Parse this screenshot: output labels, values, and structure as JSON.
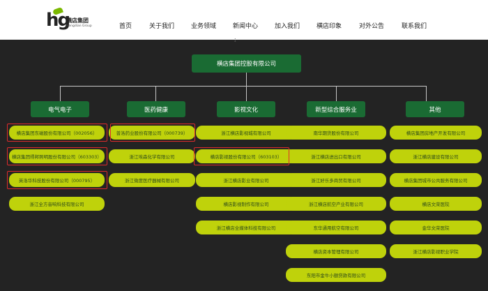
{
  "logo": {
    "mark": "hg",
    "cn": "横店集团",
    "en": "Hengdian Group"
  },
  "nav": [
    "首页",
    "关于我们",
    "业务领域",
    "新闻中心",
    "加入我们",
    "横店印象",
    "对外公告",
    "联系我们"
  ],
  "org": {
    "root": "横店集团控股有限公司",
    "categories": [
      {
        "name": "电气电子",
        "companies": [
          "横店集团东磁股份有限公司（002056）",
          "横店集团得邦照明股份有限公司（603303）",
          "英洛华科技股份有限公司（000795）",
          "浙江全方音响科技有限公司"
        ]
      },
      {
        "name": "医药健康",
        "companies": [
          "普洛药业股份有限公司（000739）",
          "浙江埃森化学有限公司",
          "浙江微度医疗器械有限公司"
        ]
      },
      {
        "name": "影视文化",
        "companies": [
          "浙江横店影视城有限公司",
          "横店影视股份有限公司（603103）",
          "浙江横店影业有限公司",
          "横店影视制作有限公司",
          "浙江横店全媒体科技有限公司"
        ]
      },
      {
        "name": "新型综合服务业",
        "companies": [
          "南华期货股份有限公司",
          "浙江横店进出口有限公司",
          "浙江好乐多商贸有限公司",
          "浙江横店航空产业有限公司",
          "东华通用航空有限公司",
          "横店资本管理有限公司",
          "东阳市金牛小额贷款有限公司"
        ]
      },
      {
        "name": "其他",
        "companies": [
          "横店集团房地产开发有限公司",
          "浙江横店建设有限公司",
          "横店集团城市公共服务有限公司",
          "横店文荣医院",
          "金华文荣医院",
          "浙江横店影视职业学院"
        ]
      }
    ]
  },
  "highlighted": [
    "横店集团东磁股份有限公司（002056）",
    "横店集团得邦照明股份有限公司（603303）",
    "英洛华科技股份有限公司（000795）",
    "普洛药业股份有限公司（000739）",
    "横店影视股份有限公司（603103）"
  ],
  "colors": {
    "page_bg": "#232323",
    "header_bg": "#ffffff",
    "node_green": "#1a6b33",
    "company_fill": "#bfd20b",
    "highlight_border": "#e02b2b",
    "connector": "#c8c8c8"
  }
}
